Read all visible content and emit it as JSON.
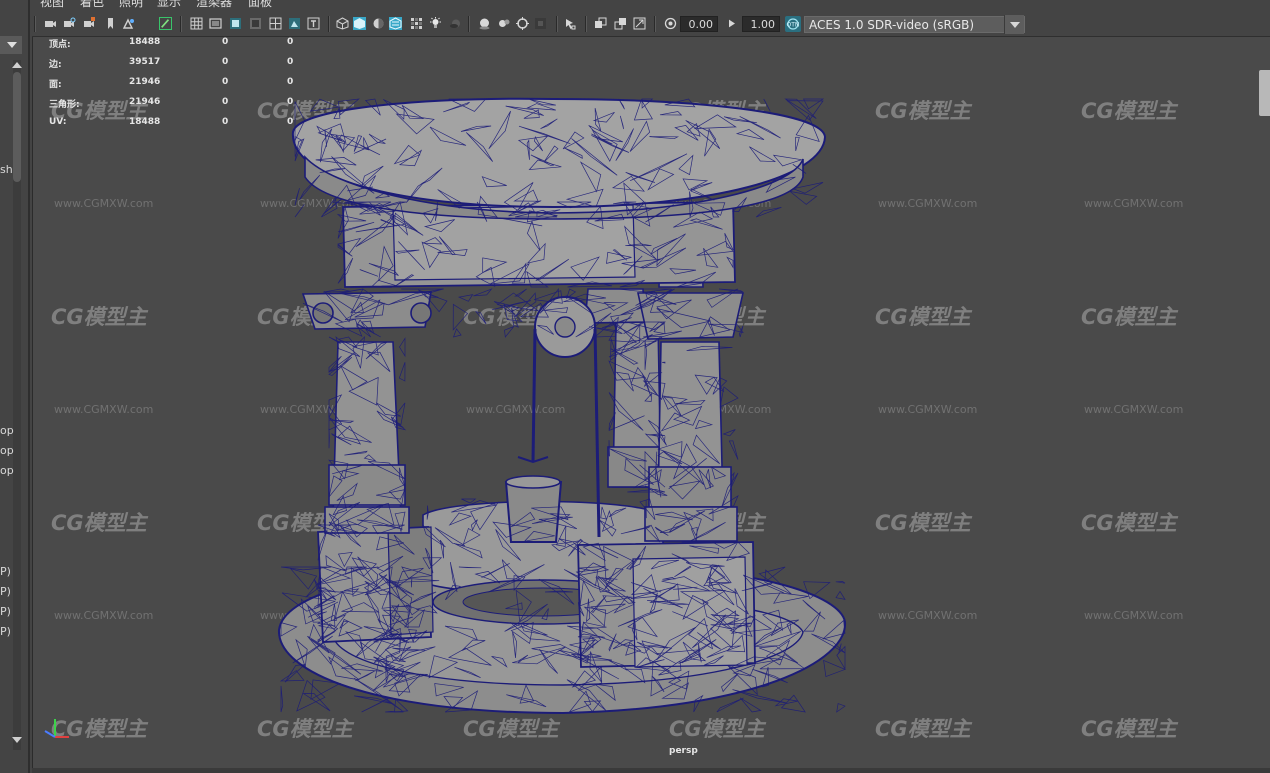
{
  "menu": {
    "items": [
      "视图",
      "着色",
      "照明",
      "显示",
      "渲染器",
      "面板"
    ]
  },
  "toolbar": {
    "exposure_value": "0.00",
    "gamma_value": "1.00",
    "color_management": "ACES 1.0 SDR-video (sRGB)",
    "icons": [
      "select-camera-icon",
      "lock-camera-icon",
      "camera-attributes-icon",
      "bookmark-icon",
      "image-plane-icon",
      "grease-pencil-icon",
      "grid-icon",
      "film-gate-icon",
      "resolution-gate-icon",
      "gate-mask-icon",
      "field-chart-icon",
      "safe-action-icon",
      "safe-title-icon",
      "wireframe-icon",
      "smooth-shade-icon",
      "default-material-icon",
      "textured-icon",
      "use-lights-icon",
      "shadows-icon",
      "screen-space-ao-icon",
      "motion-blur-icon",
      "anti-aliasing-icon",
      "depth-of-field-icon",
      "isolate-select-icon",
      "xray-icon",
      "xray-active-icon",
      "xray-joints-icon",
      "exposure-icon",
      "gamma-icon",
      "color-management-icon"
    ]
  },
  "left_panel": {
    "fragments": [
      "sh",
      "op",
      "op",
      "op",
      "P)",
      "P)",
      "P)",
      "P)"
    ]
  },
  "hud": {
    "rows": [
      {
        "label": "顶点:",
        "v1": "18488",
        "v2": "0",
        "v3": "0"
      },
      {
        "label": "边:",
        "v1": "39517",
        "v2": "0",
        "v3": "0"
      },
      {
        "label": "面:",
        "v1": "21946",
        "v2": "0",
        "v3": "0"
      },
      {
        "label": "三角形:",
        "v1": "21946",
        "v2": "0",
        "v3": "0"
      },
      {
        "label": "UV:",
        "v1": "18488",
        "v2": "0",
        "v3": "0"
      }
    ]
  },
  "viewport": {
    "camera": "persp",
    "watermark_logo": "CG模型主",
    "watermark_url": "www.CGMXW.com"
  },
  "colors": {
    "viewport_bg": "#4a4a4a",
    "wireframe": "#1c1c78",
    "mesh_fill": "#8e8e8e",
    "accent_cyan": "#28c8d8"
  }
}
